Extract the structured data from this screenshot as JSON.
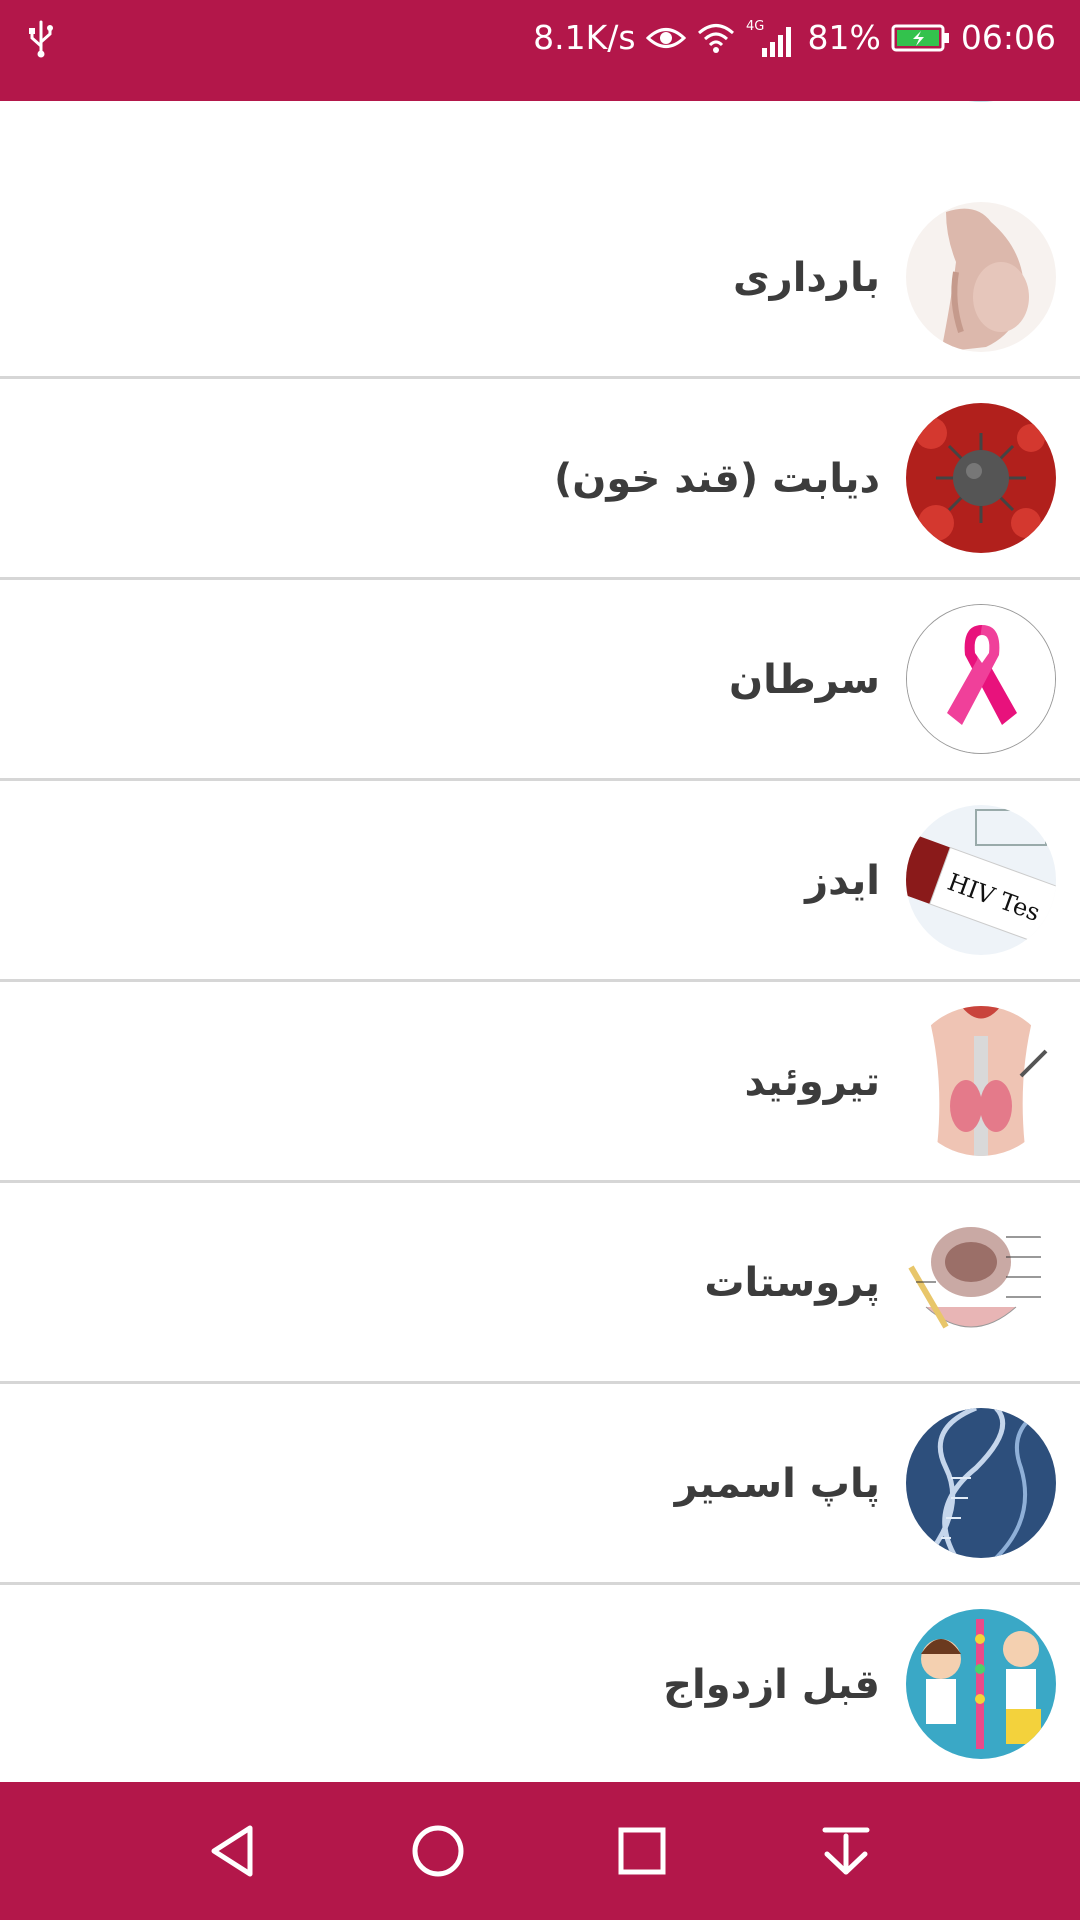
{
  "status_bar": {
    "net_speed": "8.1K/s",
    "network_type": "4G",
    "battery": "81%",
    "time": "06:06",
    "icons": [
      "usb-icon",
      "eye-icon",
      "wifi-icon",
      "signal-icon",
      "battery-charging-icon"
    ]
  },
  "colors": {
    "accent": "#b3174a",
    "divider": "#d6d6d6",
    "label": "#3c3c3c"
  },
  "list": {
    "items": [
      {
        "label": "",
        "icon": "lab-test-thumbnail"
      },
      {
        "label": "بارداری",
        "icon": "pregnancy-thumbnail"
      },
      {
        "label": "دیابت (قند خون)",
        "icon": "virus-thumbnail"
      },
      {
        "label": "سرطان",
        "icon": "pink-ribbon-thumbnail"
      },
      {
        "label": "ایدز",
        "icon": "hiv-test-tube-thumbnail"
      },
      {
        "label": "تیروئید",
        "icon": "thyroid-thumbnail"
      },
      {
        "label": "پروستات",
        "icon": "prostate-diagram-thumbnail"
      },
      {
        "label": "پاپ اسمیر",
        "icon": "dna-thumbnail"
      },
      {
        "label": "قبل ازدواج",
        "icon": "children-lab-thumbnail"
      }
    ],
    "hiv_tube_text": "HIV Tes"
  },
  "nav_bar": {
    "buttons": [
      "back-icon",
      "home-icon",
      "recents-icon",
      "notification-pull-icon"
    ]
  }
}
